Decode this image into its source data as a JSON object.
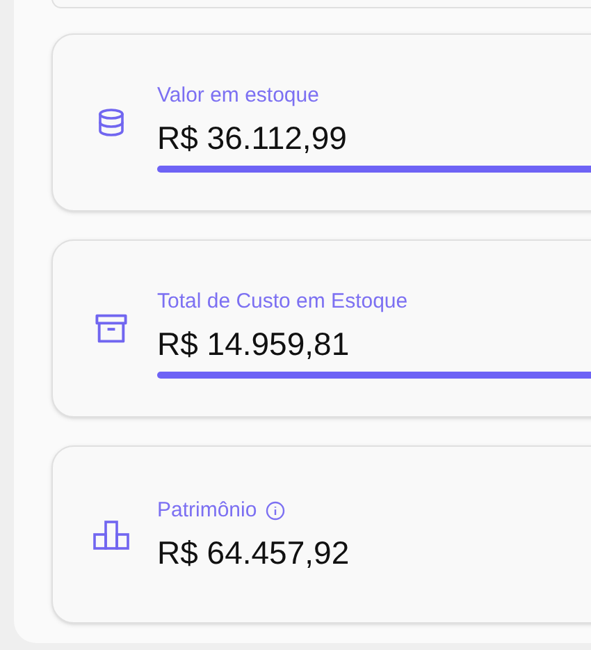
{
  "cards": [
    {
      "kind": "database",
      "label": "Valor em estoque",
      "info": false,
      "value": "R$ 36.112,99",
      "accent_bar": true
    },
    {
      "kind": "archive",
      "label": "Total de Custo em Estoque",
      "info": false,
      "value": "R$ 14.959,81",
      "accent_bar": true
    },
    {
      "kind": "chart",
      "label": "Patrimônio",
      "info": true,
      "value": "R$ 64.457,92",
      "accent_bar": false
    }
  ]
}
